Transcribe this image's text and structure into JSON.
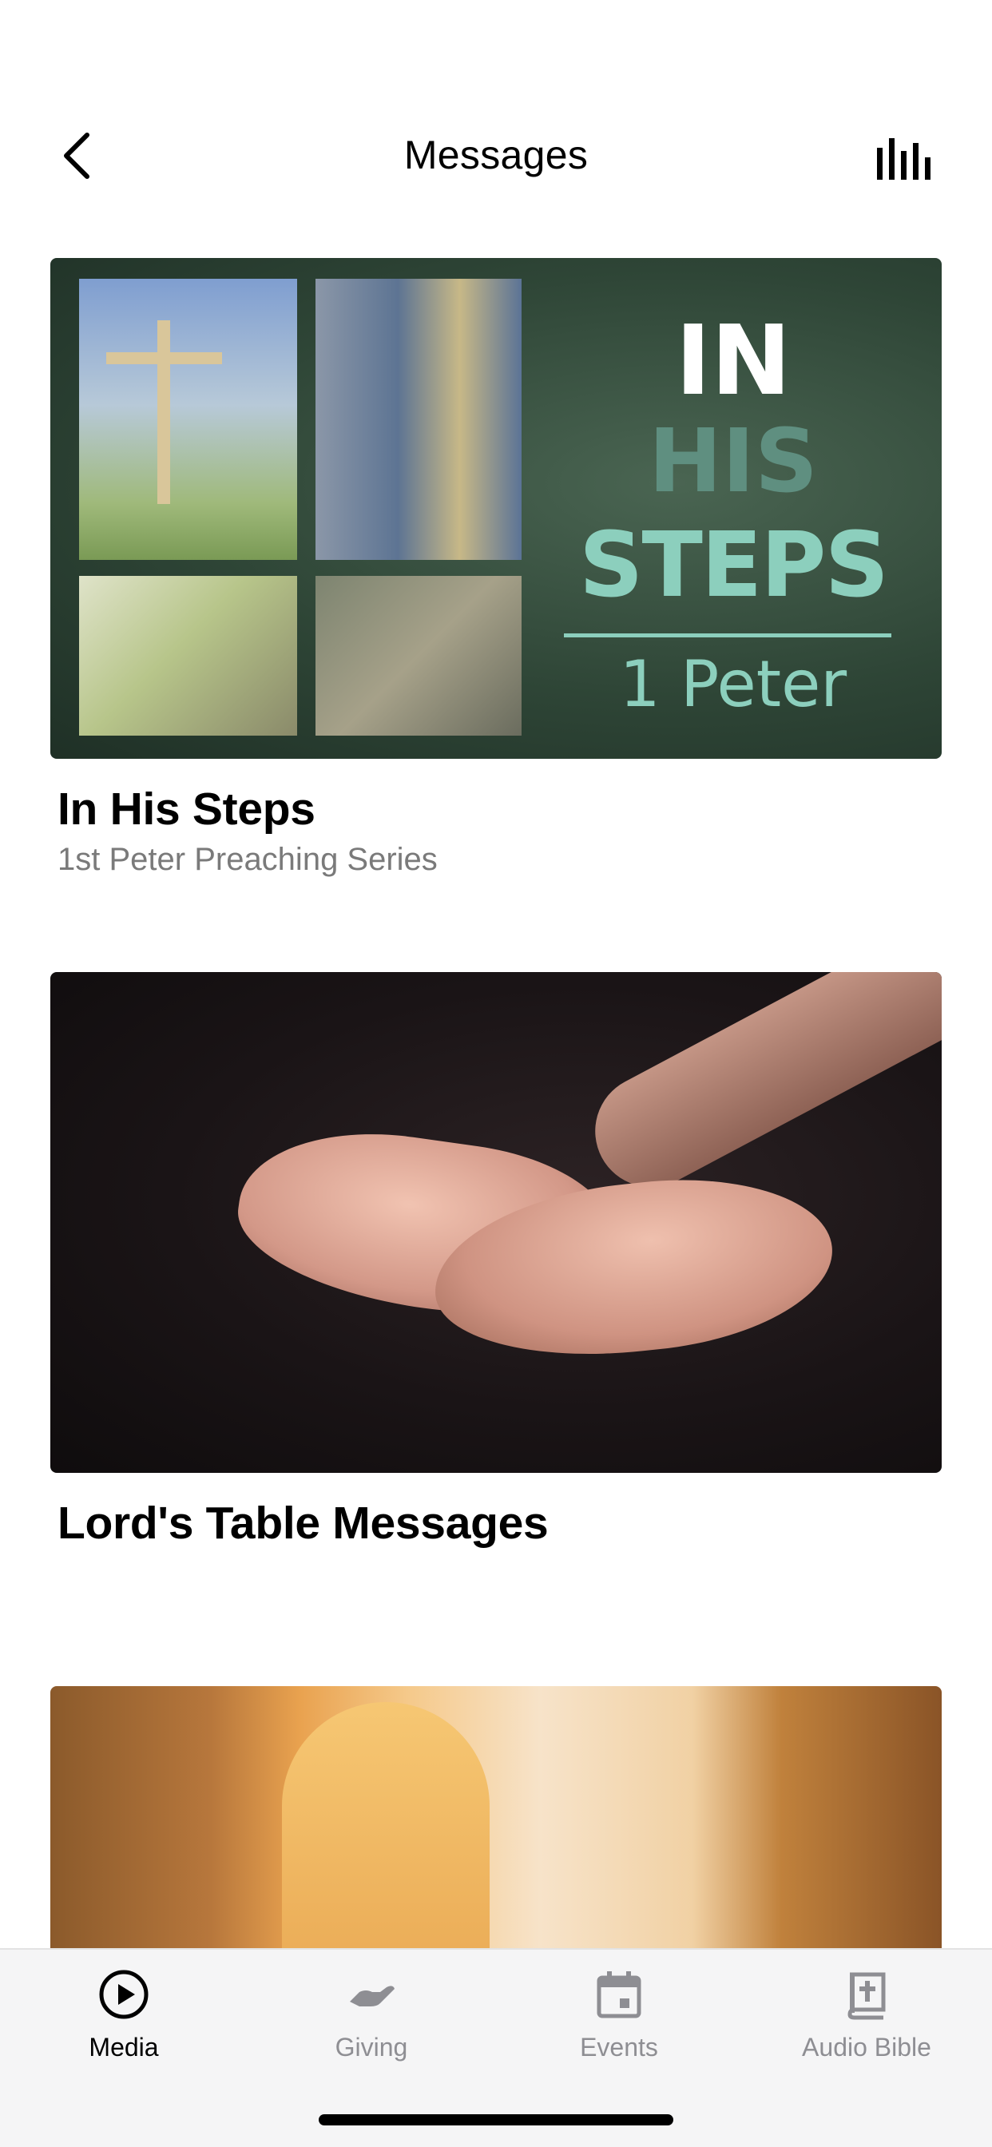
{
  "header": {
    "title": "Messages",
    "back_icon": "chevron-left-icon",
    "right_icon": "audio-bars-icon"
  },
  "cards": [
    {
      "title": "In His Steps",
      "subtitle": "1st Peter Preaching Series",
      "image_text": {
        "line1": "IN",
        "line2": "HIS",
        "line3": "STEPS",
        "line4": "1 Peter"
      }
    },
    {
      "title": "Lord's Table Messages",
      "subtitle": ""
    },
    {
      "title": "",
      "subtitle": ""
    }
  ],
  "tabbar": {
    "tabs": [
      {
        "label": "Media",
        "icon": "play-circle-icon",
        "active": true
      },
      {
        "label": "Giving",
        "icon": "giving-hand-icon",
        "active": false
      },
      {
        "label": "Events",
        "icon": "calendar-icon",
        "active": false
      },
      {
        "label": "Audio Bible",
        "icon": "bible-icon",
        "active": false
      }
    ]
  },
  "colors": {
    "active_tab": "#000000",
    "inactive_tab": "#8e8e93",
    "subtitle": "#7a7a7a",
    "art_green": "#2e4536",
    "art_mint": "#8ccfbd"
  }
}
